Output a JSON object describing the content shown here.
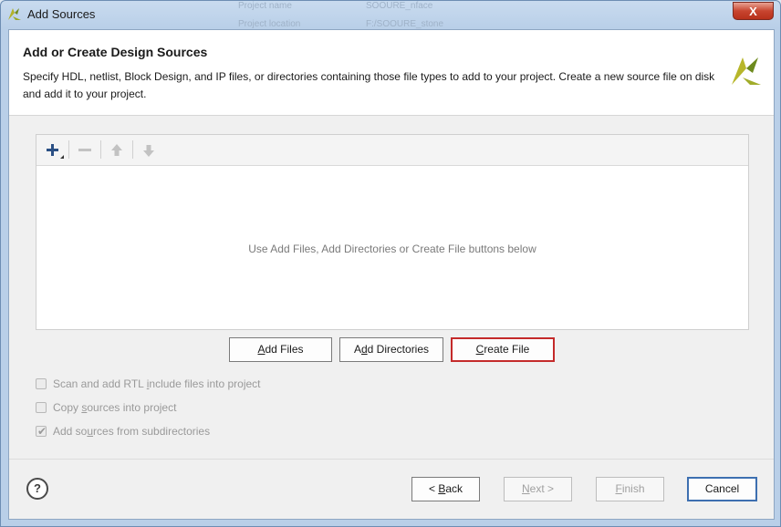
{
  "window": {
    "title": "Add Sources",
    "close_label": "X",
    "background_text": [
      "Project name",
      "SOOURE_nface",
      "Project location",
      "F:/SOOURE_stone"
    ]
  },
  "header": {
    "title": "Add or Create Design Sources",
    "description": "Specify HDL, netlist, Block Design, and IP files, or directories containing those file types to add to your project. Create a new source file on disk and add it to your project."
  },
  "toolbar": {
    "icons": [
      "add-icon",
      "remove-icon",
      "move-up-icon",
      "move-down-icon"
    ]
  },
  "files_panel": {
    "empty_message": "Use Add Files, Add Directories or Create File buttons below"
  },
  "actions": {
    "add_files": {
      "pre": "",
      "key": "A",
      "post": "dd Files"
    },
    "add_directories": {
      "pre": "A",
      "key": "d",
      "post": "d Directories"
    },
    "create_file": {
      "pre": "",
      "key": "C",
      "post": "reate File"
    }
  },
  "options": [
    {
      "pre": "Scan and add RTL ",
      "key": "i",
      "post": "nclude files into project",
      "checked": false,
      "enabled": false
    },
    {
      "pre": "Copy ",
      "key": "s",
      "post": "ources into project",
      "checked": false,
      "enabled": false
    },
    {
      "pre": "Add so",
      "key": "u",
      "post": "rces from subdirectories",
      "checked": true,
      "enabled": false
    }
  ],
  "footer": {
    "help_label": "?",
    "back": {
      "pre": "< ",
      "key": "B",
      "post": "ack"
    },
    "next": {
      "pre": "",
      "key": "N",
      "post": "ext >"
    },
    "finish": {
      "pre": "",
      "key": "F",
      "post": "inish"
    },
    "cancel_label": "Cancel"
  },
  "colors": {
    "accent_red": "#c42a2a",
    "accent_blue": "#3d6fb0",
    "logo_green": "#8a9a1f"
  }
}
